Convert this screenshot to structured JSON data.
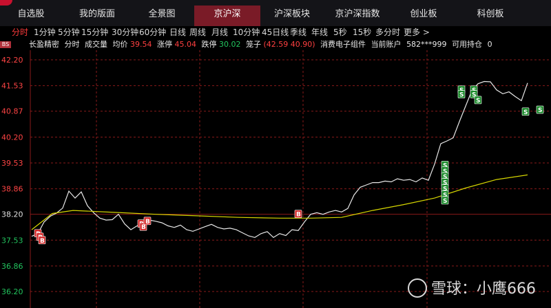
{
  "nav": {
    "tabs": [
      {
        "label": "自选股"
      },
      {
        "label": "我的版面"
      },
      {
        "label": "全景图"
      },
      {
        "label": "京沪深"
      },
      {
        "label": "沪深板块"
      },
      {
        "label": "京沪深指数"
      },
      {
        "label": "创业板"
      },
      {
        "label": "科创板"
      }
    ],
    "active_index": 3
  },
  "periods": [
    "分时",
    "1分钟",
    "5分钟",
    "15分钟",
    "30分钟",
    "60分钟",
    "日线",
    "周线",
    "月线",
    "10分钟",
    "45日线",
    "季线",
    "年线",
    "5秒",
    "15秒",
    "多分时",
    "更多 >"
  ],
  "active_period": 0,
  "badge": "BS",
  "info": {
    "stock_name": "长盈精密",
    "chart_mode": "分时",
    "volume_label": "成交量",
    "avg_label": "均价",
    "avg_value": "39.54",
    "limit_up_label": "涨停",
    "limit_up_value": "45.04",
    "limit_down_label": "跌停",
    "limit_down_value": "30.02",
    "cage_label": "笼子",
    "cage_value": "(42.59 40.90)",
    "sector": "消费电子组件",
    "account_label": "当前账户",
    "account_value": "582***999",
    "position_label": "可用持仓",
    "position_value": "0"
  },
  "y_ticks": [
    {
      "label": "42.20",
      "color": "red"
    },
    {
      "label": "41.53",
      "color": "red"
    },
    {
      "label": "40.87",
      "color": "red"
    },
    {
      "label": "40.20",
      "color": "red"
    },
    {
      "label": "39.53",
      "color": "red"
    },
    {
      "label": "38.86",
      "color": "red"
    },
    {
      "label": "38.20",
      "color": "white"
    },
    {
      "label": "37.53",
      "color": "green"
    },
    {
      "label": "36.86",
      "color": "green"
    },
    {
      "label": "36.20",
      "color": "green"
    }
  ],
  "colors": {
    "price_line": "#e8e8e8",
    "avg_line": "#d8d800",
    "buy_marker": "#d42a2a",
    "sell_marker": "#1a8a2a",
    "grid": "#8a1a1a"
  },
  "chart_data": {
    "type": "line",
    "ylim": [
      36.0,
      42.3
    ],
    "x_count": 241,
    "series": [
      {
        "name": "",
        "values_sampled": [
          [
            0,
            37.63
          ],
          [
            3,
            37.7
          ],
          [
            6,
            38.0
          ],
          [
            9,
            38.15
          ],
          [
            12,
            38.23
          ],
          [
            15,
            38.36
          ],
          [
            18,
            38.8
          ],
          [
            21,
            38.62
          ],
          [
            24,
            38.78
          ],
          [
            27,
            38.42
          ],
          [
            30,
            38.24
          ],
          [
            33,
            38.1
          ],
          [
            36,
            38.05
          ],
          [
            39,
            38.06
          ],
          [
            42,
            38.2
          ],
          [
            45,
            37.95
          ],
          [
            48,
            37.8
          ],
          [
            51,
            37.9
          ],
          [
            54,
            37.96
          ],
          [
            57,
            38.05
          ],
          [
            60,
            38.02
          ],
          [
            63,
            37.98
          ],
          [
            66,
            37.9
          ],
          [
            69,
            37.86
          ],
          [
            72,
            37.92
          ],
          [
            75,
            37.8
          ],
          [
            78,
            37.76
          ],
          [
            81,
            37.82
          ],
          [
            84,
            37.88
          ],
          [
            87,
            37.94
          ],
          [
            90,
            37.86
          ],
          [
            93,
            37.82
          ],
          [
            96,
            37.84
          ],
          [
            99,
            37.8
          ],
          [
            102,
            37.72
          ],
          [
            105,
            37.64
          ],
          [
            108,
            37.6
          ],
          [
            111,
            37.7
          ],
          [
            114,
            37.75
          ],
          [
            117,
            37.6
          ],
          [
            120,
            37.7
          ],
          [
            123,
            37.65
          ],
          [
            126,
            37.8
          ],
          [
            129,
            37.78
          ],
          [
            132,
            38.0
          ],
          [
            135,
            38.2
          ],
          [
            138,
            38.24
          ],
          [
            141,
            38.2
          ],
          [
            144,
            38.26
          ],
          [
            147,
            38.3
          ],
          [
            150,
            38.26
          ],
          [
            153,
            38.35
          ],
          [
            156,
            38.7
          ],
          [
            159,
            38.9
          ],
          [
            162,
            38.96
          ],
          [
            165,
            39.02
          ],
          [
            168,
            39.02
          ],
          [
            171,
            39.06
          ],
          [
            174,
            39.04
          ],
          [
            177,
            39.12
          ],
          [
            180,
            39.08
          ],
          [
            183,
            39.1
          ],
          [
            186,
            39.04
          ],
          [
            189,
            39.14
          ],
          [
            192,
            39.08
          ],
          [
            195,
            39.5
          ],
          [
            198,
            40.03
          ],
          [
            201,
            40.1
          ],
          [
            204,
            40.18
          ],
          [
            207,
            40.6
          ],
          [
            210,
            41.0
          ],
          [
            213,
            41.4
          ],
          [
            216,
            41.58
          ],
          [
            219,
            41.64
          ],
          [
            222,
            41.63
          ],
          [
            225,
            41.42
          ],
          [
            228,
            41.32
          ],
          [
            231,
            41.37
          ],
          [
            234,
            41.25
          ],
          [
            237,
            41.14
          ],
          [
            240,
            41.6
          ]
        ]
      },
      {
        "name": "",
        "values_sampled": [
          [
            0,
            37.8
          ],
          [
            10,
            38.22
          ],
          [
            20,
            38.3
          ],
          [
            40,
            38.25
          ],
          [
            60,
            38.2
          ],
          [
            80,
            38.16
          ],
          [
            100,
            38.12
          ],
          [
            120,
            38.1
          ],
          [
            135,
            38.1
          ],
          [
            150,
            38.12
          ],
          [
            165,
            38.3
          ],
          [
            180,
            38.45
          ],
          [
            195,
            38.62
          ],
          [
            210,
            38.88
          ],
          [
            225,
            39.1
          ],
          [
            240,
            39.22
          ]
        ]
      }
    ],
    "markers": [
      {
        "type": "B",
        "x": 3,
        "y": 37.7
      },
      {
        "type": "B",
        "x": 4,
        "y": 37.61
      },
      {
        "type": "B",
        "x": 5,
        "y": 37.52
      },
      {
        "type": "B",
        "x": 53,
        "y": 37.95
      },
      {
        "type": "B",
        "x": 54,
        "y": 37.87
      },
      {
        "type": "B",
        "x": 56,
        "y": 38.02
      },
      {
        "type": "B",
        "x": 129,
        "y": 38.2
      },
      {
        "type": "S",
        "x": 200,
        "y": 39.47
      },
      {
        "type": "S",
        "x": 200,
        "y": 39.32
      },
      {
        "type": "S",
        "x": 200,
        "y": 39.17
      },
      {
        "type": "S",
        "x": 200,
        "y": 39.02
      },
      {
        "type": "S",
        "x": 200,
        "y": 38.86
      },
      {
        "type": "S",
        "x": 200,
        "y": 38.7
      },
      {
        "type": "S",
        "x": 200,
        "y": 38.55
      },
      {
        "type": "S",
        "x": 208,
        "y": 41.42
      },
      {
        "type": "S",
        "x": 208,
        "y": 41.3
      },
      {
        "type": "S",
        "x": 214,
        "y": 41.42
      },
      {
        "type": "S",
        "x": 214,
        "y": 41.3
      },
      {
        "type": "S",
        "x": 216,
        "y": 41.15
      },
      {
        "type": "S",
        "x": 239,
        "y": 40.85
      },
      {
        "type": "S",
        "x": 246,
        "y": 40.9
      }
    ]
  },
  "watermark": "雪球：小鹰666"
}
